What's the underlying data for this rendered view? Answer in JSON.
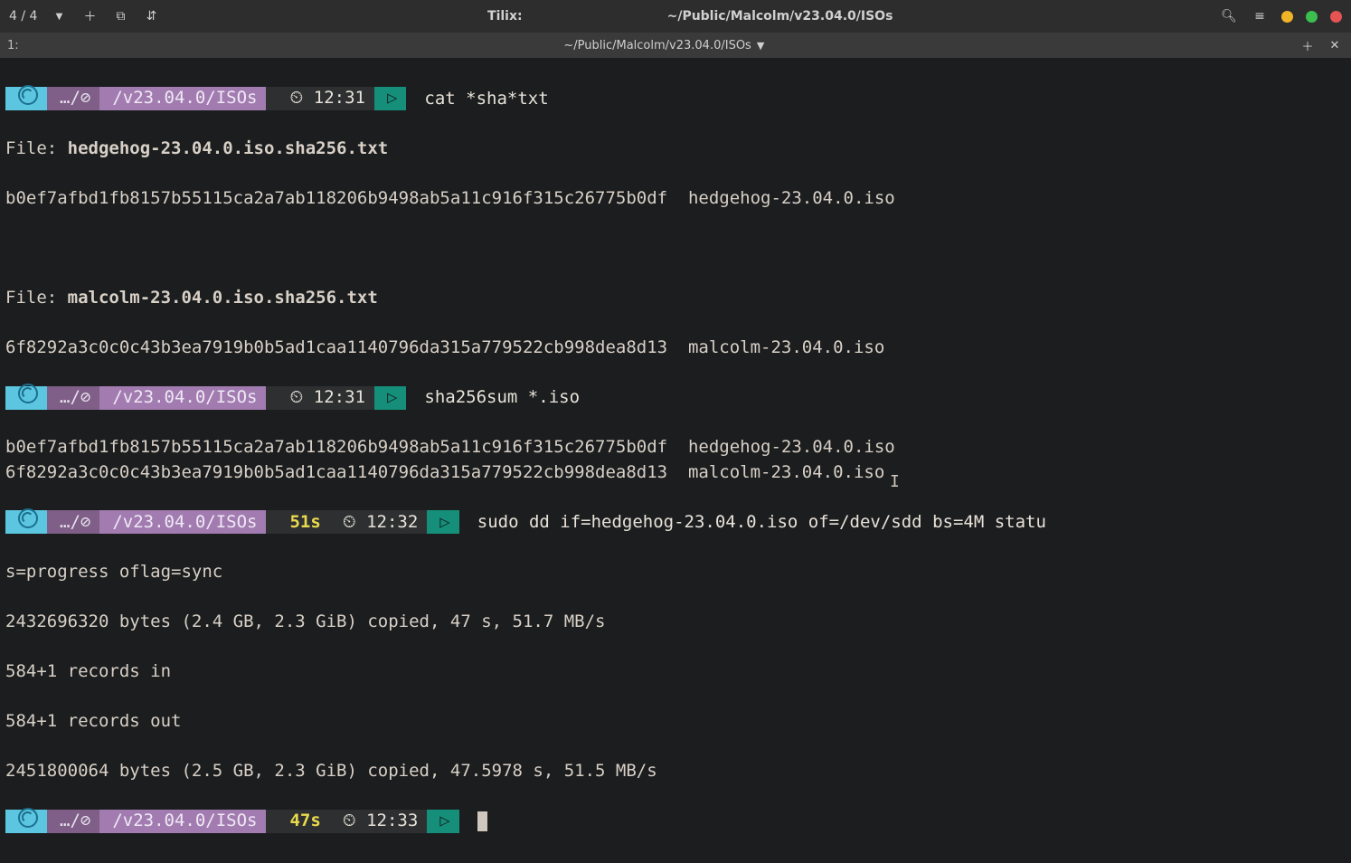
{
  "window": {
    "pane_index": "4 / 4",
    "app_title": "Tilix:",
    "cwd_title": "~/Public/Malcolm/v23.04.0/ISOs"
  },
  "tab": {
    "number": "1:",
    "path": "~/Public/Malcolm/v23.04.0/ISOs"
  },
  "prompt_path_short": "…/⊘",
  "prompt_path_tail": "/v23.04.0/ISOs",
  "prompts": [
    {
      "duration": "",
      "time": "12:31",
      "command": "cat *sha*txt"
    },
    {
      "duration": "",
      "time": "12:31",
      "command": "sha256sum *.iso"
    },
    {
      "duration": "51s",
      "time": "12:32",
      "command": "sudo dd if=hedgehog-23.04.0.iso of=/dev/sdd bs=4M statu"
    },
    {
      "duration": "47s",
      "time": "12:33",
      "command": ""
    }
  ],
  "output": {
    "file1_label": "File: ",
    "file1_name": "hedgehog-23.04.0.iso.sha256.txt",
    "file1_line": "b0ef7afbd1fb8157b55115ca2a7ab118206b9498ab5a11c916f315c26775b0df  hedgehog-23.04.0.iso",
    "file2_label": "File: ",
    "file2_name": "malcolm-23.04.0.iso.sha256.txt",
    "file2_line": "6f8292a3c0c0c43b3ea7919b0b5ad1caa1140796da315a779522cb998dea8d13  malcolm-23.04.0.iso",
    "sha_lines": "b0ef7afbd1fb8157b55115ca2a7ab118206b9498ab5a11c916f315c26775b0df  hedgehog-23.04.0.iso\n6f8292a3c0c0c43b3ea7919b0b5ad1caa1140796da315a779522cb998dea8d13  malcolm-23.04.0.iso",
    "dd_wrap": "s=progress oflag=sync",
    "dd_progress": "2432696320 bytes (2.4 GB, 2.3 GiB) copied, 47 s, 51.7 MB/s",
    "dd_rec_in": "584+1 records in",
    "dd_rec_out": "584+1 records out",
    "dd_final": "2451800064 bytes (2.5 GB, 2.3 GiB) copied, 47.5978 s, 51.5 MB/s"
  }
}
